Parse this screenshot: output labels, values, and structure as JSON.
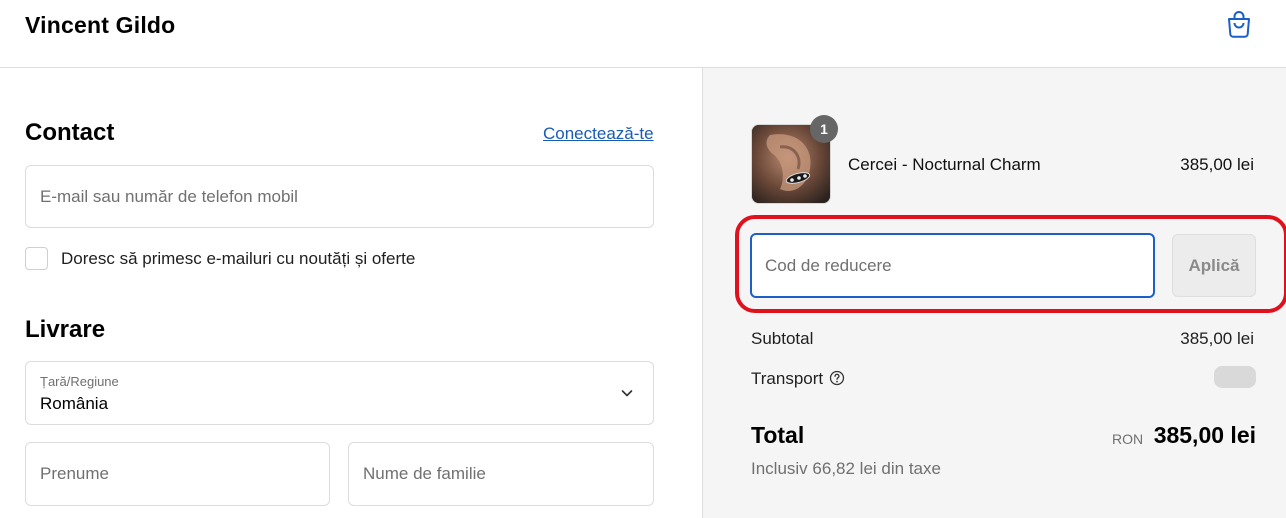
{
  "header": {
    "store_name": "Vincent Gildo",
    "cart_icon": "shopping-bag-icon",
    "accent_color": "#1d5fc9"
  },
  "contact": {
    "title": "Contact",
    "login_link": "Conectează-te",
    "email_placeholder": "E-mail sau număr de telefon mobil",
    "newsletter_label": "Doresc să primesc e-mailuri cu noutăți și oferte",
    "newsletter_checked": false
  },
  "delivery": {
    "title": "Livrare",
    "country_label": "Țară/Regiune",
    "country_value": "România",
    "first_name_placeholder": "Prenume",
    "last_name_placeholder": "Nume de familie"
  },
  "order_summary": {
    "product": {
      "name": "Cercei - Nocturnal Charm",
      "price": "385,00 lei",
      "quantity": "1"
    },
    "discount": {
      "placeholder": "Cod de reducere",
      "apply_label": "Aplică"
    },
    "subtotal_label": "Subtotal",
    "subtotal_value": "385,00 lei",
    "shipping_label": "Transport",
    "total_label": "Total",
    "total_currency": "RON",
    "total_value": "385,00 lei",
    "tax_note": "Inclusiv 66,82 lei din taxe"
  },
  "highlight_color": "#e0101c"
}
